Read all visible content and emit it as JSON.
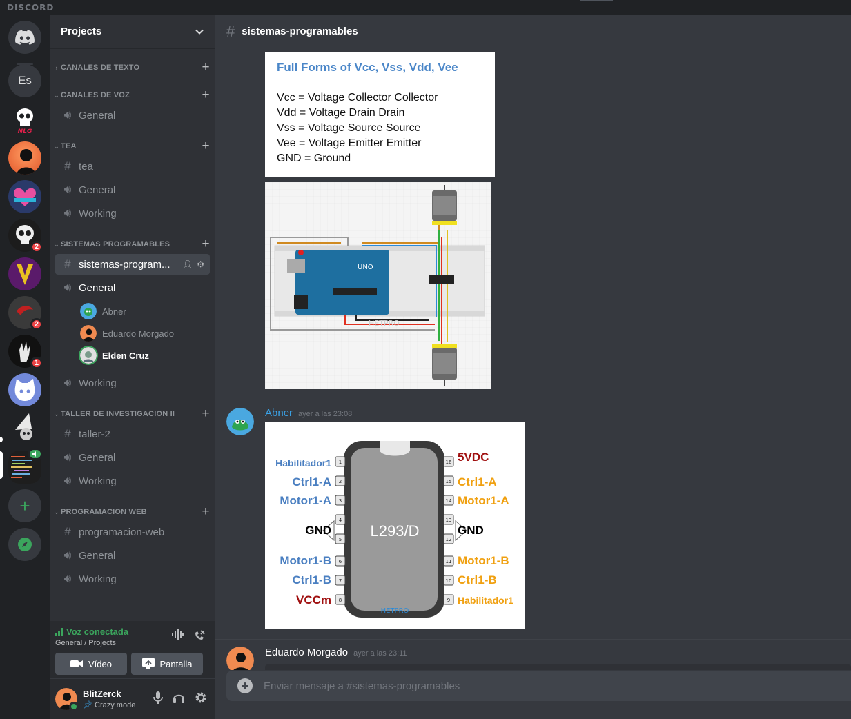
{
  "app": {
    "brand": "DISCORD"
  },
  "rail": {
    "home_label": "Discord",
    "servers": [
      {
        "abbr": "Es"
      },
      {
        "abbr": "NLG"
      },
      {
        "abbr": ""
      },
      {
        "abbr": ""
      },
      {
        "abbr": "",
        "badge": "2"
      },
      {
        "abbr": ""
      },
      {
        "abbr": "",
        "badge": "2"
      },
      {
        "abbr": "",
        "badge": "1"
      },
      {
        "abbr": ""
      },
      {
        "abbr": ""
      },
      {
        "abbr": ""
      }
    ]
  },
  "guild": {
    "name": "Projects"
  },
  "categories": [
    {
      "label": "CANALES DE TEXTO",
      "collapsed": true
    },
    {
      "label": "CANALES DE VOZ"
    },
    {
      "label": "TEA"
    },
    {
      "label": "SISTEMAS PROGRAMABLES"
    },
    {
      "label": "TALLER DE INVESTIGACION II"
    },
    {
      "label": "PROGRAMACION WEB"
    }
  ],
  "channels": {
    "voz_general": "General",
    "tea_text": "tea",
    "tea_general": "General",
    "tea_working": "Working",
    "sp_text": "sistemas-program...",
    "sp_general": "General",
    "sp_working": "Working",
    "ti_text": "taller-2",
    "ti_general": "General",
    "ti_working": "Working",
    "pw_text": "programacion-web",
    "pw_general": "General",
    "pw_working": "Working"
  },
  "voice_users": [
    {
      "name": "Abner"
    },
    {
      "name": "Eduardo Morgado"
    },
    {
      "name": "Elden Cruz",
      "speaking": true
    }
  ],
  "rtc": {
    "status": "Voz conectada",
    "location": "General / Projects",
    "video_label": "Vídeo",
    "screen_label": "Pantalla"
  },
  "user": {
    "name": "BlitZerck",
    "status": "Crazy mode"
  },
  "channel_header": {
    "name": "sistemas-programables"
  },
  "card_vcc": {
    "title": "Full Forms of Vcc, Vss, Vdd, Vee",
    "lines": [
      "Vcc = Voltage Collector Collector",
      "Vdd = Voltage Drain Drain",
      "Vss = Voltage Source Source",
      "Vee = Voltage Emitter Emitter",
      "GND = Ground"
    ]
  },
  "circuit": {
    "board_label": "UNO",
    "watermark": "HETPRO"
  },
  "messages": [
    {
      "author": "Abner",
      "time": "ayer a las 23:08",
      "color": "#3ba3e8"
    },
    {
      "author": "Eduardo Morgado",
      "time": "ayer a las 23:11",
      "color": "#ffffff"
    }
  ],
  "l293": {
    "chip": "L293/D",
    "watermark": "HETPRO",
    "left": [
      {
        "pin": "1",
        "label": "Habilitador1",
        "color": "#4a7fc1"
      },
      {
        "pin": "2",
        "label": "Ctrl1-A",
        "color": "#4a7fc1"
      },
      {
        "pin": "3",
        "label": "Motor1-A",
        "color": "#4a7fc1"
      },
      {
        "pin": "4",
        "label": "GND",
        "color": "#000000"
      },
      {
        "pin": "5",
        "label": "",
        "color": "#000000"
      },
      {
        "pin": "6",
        "label": "Motor1-B",
        "color": "#4a7fc1"
      },
      {
        "pin": "7",
        "label": "Ctrl1-B",
        "color": "#4a7fc1"
      },
      {
        "pin": "8",
        "label": "VCCm",
        "color": "#a01010"
      }
    ],
    "right": [
      {
        "pin": "16",
        "label": "5VDC",
        "color": "#a01010"
      },
      {
        "pin": "15",
        "label": "Ctrl1-A",
        "color": "#f0a010"
      },
      {
        "pin": "14",
        "label": "Motor1-A",
        "color": "#f0a010"
      },
      {
        "pin": "13",
        "label": "GND",
        "color": "#000000"
      },
      {
        "pin": "12",
        "label": "",
        "color": "#000000"
      },
      {
        "pin": "11",
        "label": "Motor1-B",
        "color": "#f0a010"
      },
      {
        "pin": "10",
        "label": "Ctrl1-B",
        "color": "#f0a010"
      },
      {
        "pin": "9",
        "label": "Habilitador1",
        "color": "#f0a010"
      }
    ]
  },
  "composer": {
    "placeholder": "Enviar mensaje a #sistemas-programables"
  }
}
